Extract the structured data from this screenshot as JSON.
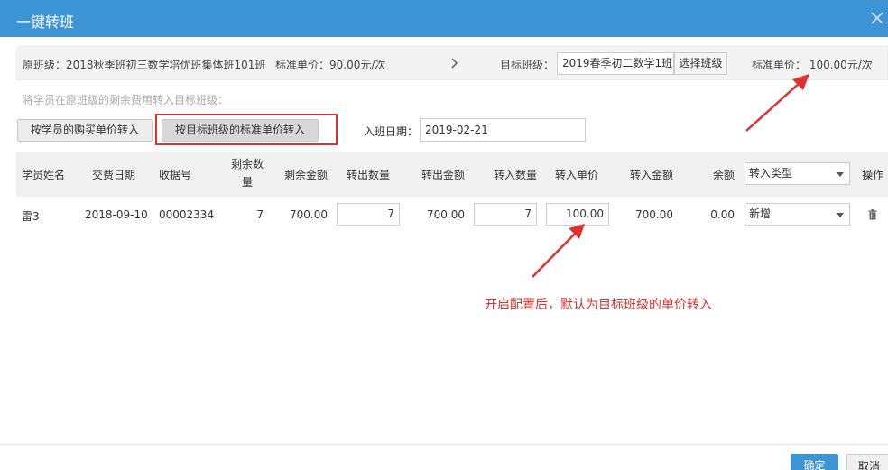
{
  "dialog": {
    "title": "一键转班"
  },
  "source": {
    "class_label": "原班级：2018秋季班初三数学培优班集体班101班",
    "price_label": "标准单价：90.00元/次"
  },
  "target": {
    "label": "目标班级：",
    "class_value": "2019春季初二数学1班",
    "select_button": "选择班级",
    "price_label": "标准单价：  100.00元/次"
  },
  "hint": "将学员在原班级的剩余费用转入目标班级：",
  "modes": {
    "by_purchase": "按学员的购买单价转入",
    "by_target": "按目标班级的标准单价转入"
  },
  "enroll_date": {
    "label": "入班日期：",
    "value": "2019-02-21"
  },
  "table": {
    "headers": {
      "name": "学员姓名",
      "pay_date": "交费日期",
      "receipt": "收据号",
      "remain_qty_1": "剩余数",
      "remain_qty_2": "量",
      "remain_amount": "剩余金额",
      "out_qty": "转出数量",
      "out_amount": "转出金额",
      "in_qty": "转入数量",
      "in_price": "转入单价",
      "in_amount": "转入金额",
      "balance": "余额",
      "type_select": "转入类型",
      "action": "操作"
    },
    "rows": [
      {
        "name": "雷3",
        "pay_date": "2018-09-10",
        "receipt": "00002334",
        "remain_qty": "7",
        "remain_amount": "700.00",
        "out_qty": "7",
        "out_amount": "700.00",
        "in_qty": "7",
        "in_price": "100.00",
        "in_amount": "700.00",
        "balance": "0.00",
        "type": "新增"
      }
    ]
  },
  "annotation": "开启配置后，默认为目标班级的单价转入",
  "footer": {
    "ok": "确定",
    "cancel": "取消"
  },
  "colors": {
    "header": "#3d94d4",
    "annotation": "#d9322a"
  }
}
